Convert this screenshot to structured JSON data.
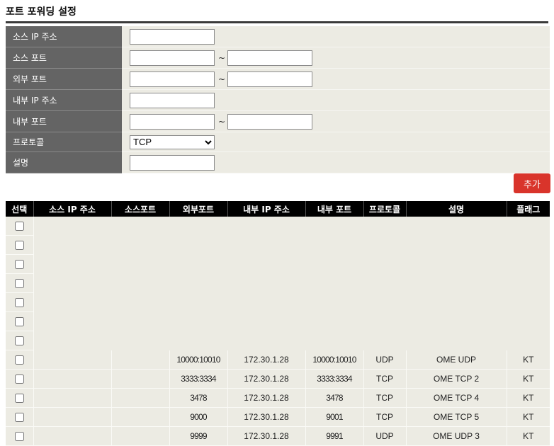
{
  "page": {
    "title": "포트 포워딩 설정"
  },
  "form": {
    "src_ip_label": "소스 IP 주소",
    "src_port_label": "소스 포트",
    "ext_port_label": "외부 포트",
    "int_ip_label": "내부 IP 주소",
    "int_port_label": "내부 포트",
    "protocol_label": "프로토콜",
    "desc_label": "설명",
    "range_sep": "~",
    "protocol_value": "TCP",
    "src_ip_value": "",
    "src_port_from": "",
    "src_port_to": "",
    "ext_port_from": "",
    "ext_port_to": "",
    "int_ip_value": "",
    "int_port_from": "",
    "int_port_to": "",
    "desc_value": ""
  },
  "add_button": {
    "label": "추가",
    "color": "#d9342b"
  },
  "table": {
    "headers": [
      "선택",
      "소스 IP 주소",
      "소스포트",
      "외부포트",
      "내부 IP 주소",
      "내부 포트",
      "프로토콜",
      "설명",
      "플래그"
    ],
    "empty_rows": 7,
    "rows": [
      {
        "checked": false,
        "src_ip": "",
        "src_port": "",
        "ext_port": "10000:10010",
        "int_ip": "172.30.1.28",
        "int_port": "10000:10010",
        "protocol": "UDP",
        "desc": "OME UDP",
        "flag": "KT"
      },
      {
        "checked": false,
        "src_ip": "",
        "src_port": "",
        "ext_port": "3333:3334",
        "int_ip": "172.30.1.28",
        "int_port": "3333:3334",
        "protocol": "TCP",
        "desc": "OME TCP 2",
        "flag": "KT"
      },
      {
        "checked": false,
        "src_ip": "",
        "src_port": "",
        "ext_port": "3478",
        "int_ip": "172.30.1.28",
        "int_port": "3478",
        "protocol": "TCP",
        "desc": "OME TCP 4",
        "flag": "KT"
      },
      {
        "checked": false,
        "src_ip": "",
        "src_port": "",
        "ext_port": "9000",
        "int_ip": "172.30.1.28",
        "int_port": "9001",
        "protocol": "TCP",
        "desc": "OME TCP 5",
        "flag": "KT"
      },
      {
        "checked": false,
        "src_ip": "",
        "src_port": "",
        "ext_port": "9999",
        "int_ip": "172.30.1.28",
        "int_port": "9991",
        "protocol": "UDP",
        "desc": "OME UDP 3",
        "flag": "KT"
      }
    ]
  },
  "colors": {
    "label_bg": "#646464",
    "field_bg": "#ecebe3",
    "header_bg": "#000000",
    "accent": "#d9342b"
  }
}
